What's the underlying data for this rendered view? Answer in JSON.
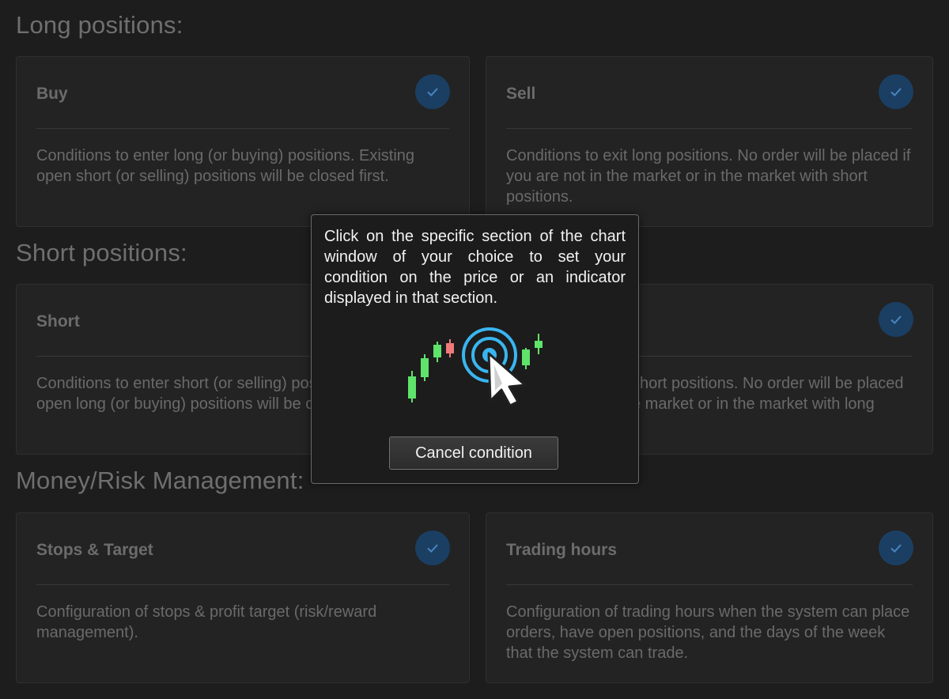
{
  "sections": {
    "long": "Long positions:",
    "short": "Short positions:",
    "money": "Money/Risk Management:"
  },
  "cards": {
    "buy": {
      "title": "Buy",
      "desc": "Conditions to enter long (or buying) positions. Existing open short (or selling) positions will be closed first."
    },
    "sell": {
      "title": "Sell",
      "desc": "Conditions to exit long positions.  No order will be placed if you are not in the market or in the market with short positions."
    },
    "short": {
      "title": "Short",
      "desc": "Conditions to enter short (or selling) positions. Existing open long (or buying) positions will be closed first."
    },
    "cover": {
      "title": "",
      "desc": "Conditions to exit short positions.  No order will be placed if you are not in the market or in the market with long positions."
    },
    "stops": {
      "title": "Stops & Target",
      "desc": "Configuration of stops & profit target (risk/reward management)."
    },
    "hours": {
      "title": "Trading hours",
      "desc": "Configuration of trading hours when the system can place orders, have open positions, and the days of the week that the system can trade."
    }
  },
  "modal": {
    "message": "Click on the specific section of the chart window of your choice to set your condition on the price or an indicator displayed in that section.",
    "cancel_label": "Cancel condition",
    "illustration_icon": "chart-click-icon"
  },
  "colors": {
    "check_bg": "#1b3f63",
    "check_mark": "#4a86c0",
    "candle_up": "#5fe36b",
    "candle_down": "#ef7a7a",
    "target_ring": "#39b6f0"
  }
}
